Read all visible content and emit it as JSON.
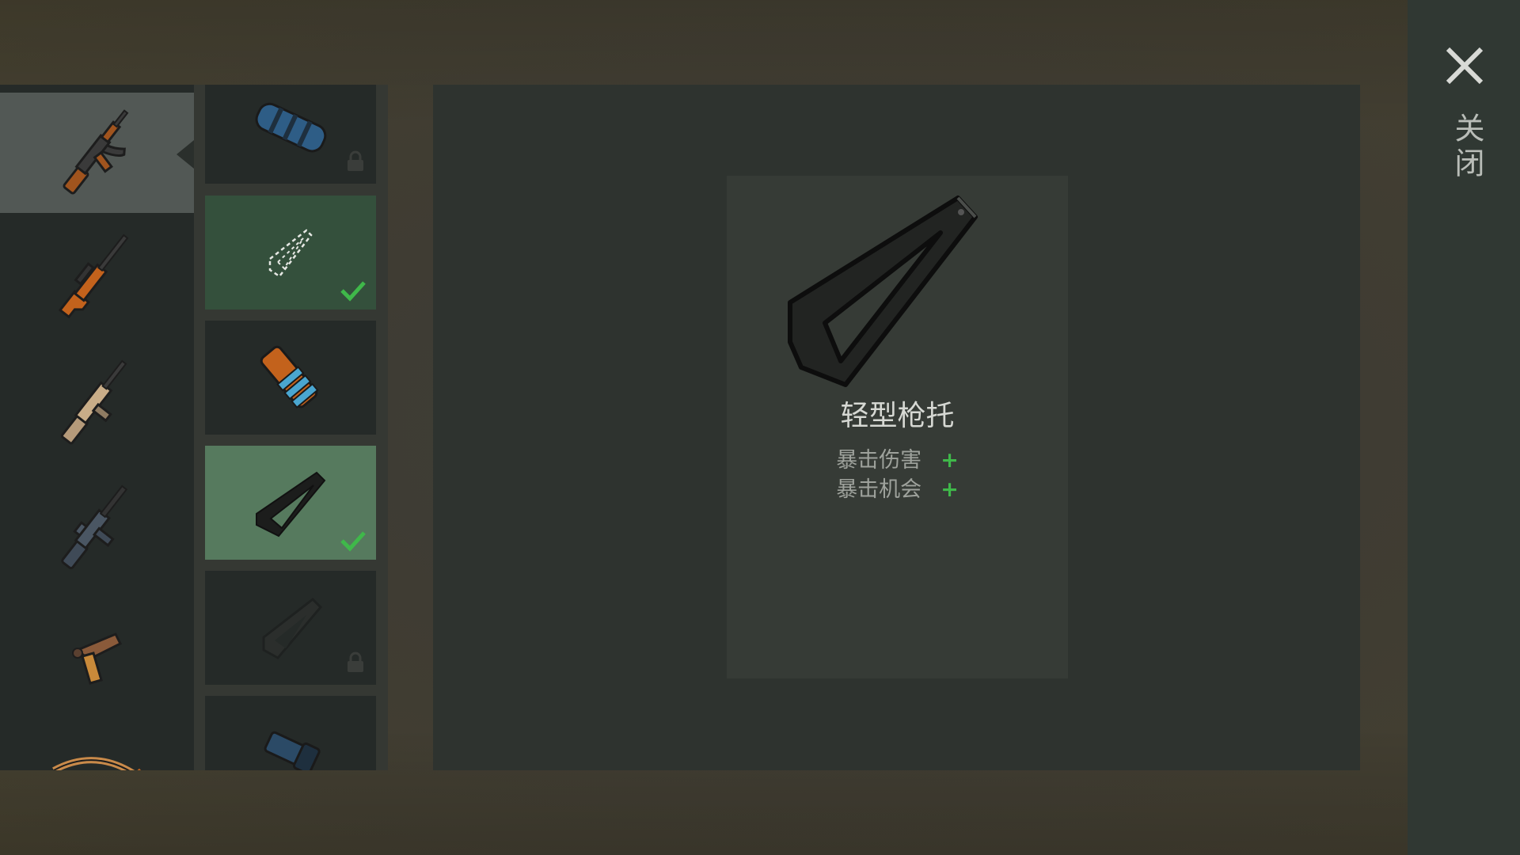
{
  "weapons": [
    {
      "name": "ak-rifle-icon",
      "selected": true
    },
    {
      "name": "sniper-rifle-icon",
      "selected": false
    },
    {
      "name": "scar-rifle-icon",
      "selected": false
    },
    {
      "name": "m16-rifle-icon",
      "selected": false
    },
    {
      "name": "flare-pistol-icon",
      "selected": false
    },
    {
      "name": "crossbow-icon",
      "selected": false
    }
  ],
  "attachments": [
    {
      "name": "suppressor-icon",
      "state": "locked"
    },
    {
      "name": "empty-stock-slot-icon",
      "state": "equipped"
    },
    {
      "name": "wrapped-grip-icon",
      "state": "available"
    },
    {
      "name": "light-stock-icon",
      "state": "equipped-active"
    },
    {
      "name": "tactical-stock-icon",
      "state": "locked"
    },
    {
      "name": "scope-icon",
      "state": "available"
    }
  ],
  "detail": {
    "title": "轻型枪托",
    "stats": [
      {
        "label": "暴击伤害",
        "bonus": "+"
      },
      {
        "label": "暴击机会",
        "bonus": "+"
      }
    ]
  },
  "close": {
    "label": "关闭"
  },
  "colors": {
    "positive": "#3fb84a",
    "equipped": "#34503c",
    "active": "#567a5e"
  }
}
